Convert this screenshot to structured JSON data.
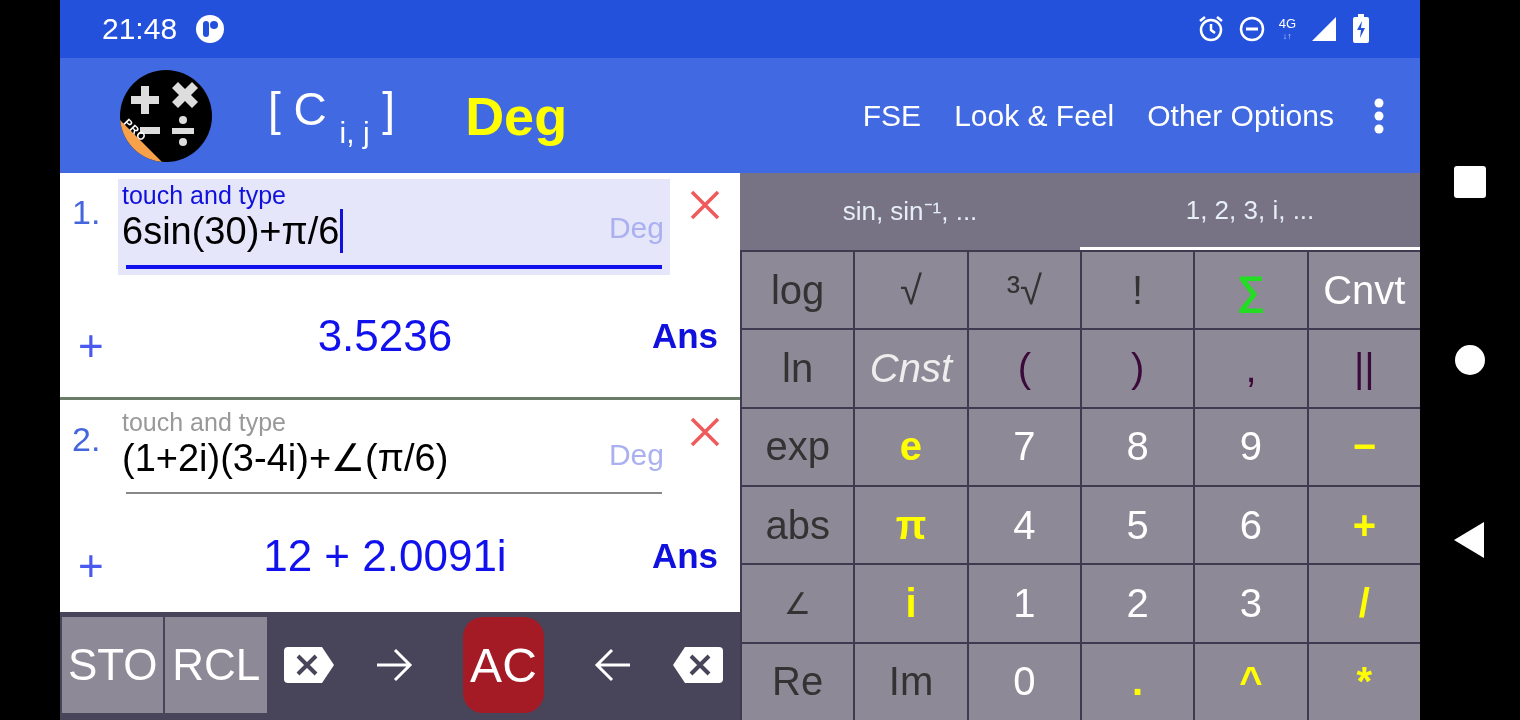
{
  "status_bar": {
    "time": "21:48",
    "network": "4G",
    "network_arrows": "↓↑"
  },
  "app_bar": {
    "logo_badge": "PRO",
    "title": "[ C $_{i, j}$ ]",
    "mode": "Deg",
    "menu": [
      "FSE",
      "Look & Feel",
      "Other Options"
    ]
  },
  "entries": [
    {
      "number": "1.",
      "hint": "touch and type",
      "expression": "6sin(30)+π/6",
      "mode": "Deg",
      "result": "3.5236",
      "answer": "Ans",
      "add": "+",
      "focused": true
    },
    {
      "number": "2.",
      "hint": "touch and type",
      "expression": "(1+2i)(3-4i)+∠(π/6)",
      "mode": "Deg",
      "result": "12 + 2.0091i",
      "answer": "Ans",
      "add": "+",
      "focused": false
    }
  ],
  "action_bar": [
    {
      "kind": "memory",
      "label": "STO"
    },
    {
      "kind": "memory",
      "label": "RCL"
    },
    {
      "kind": "delete-forward"
    },
    {
      "kind": "cursor-right"
    },
    {
      "kind": "clear",
      "label": "AC"
    },
    {
      "kind": "cursor-left"
    },
    {
      "kind": "backspace"
    }
  ],
  "keypad_tabs": [
    {
      "label": "sin, sin⁻¹, ...",
      "selected": false
    },
    {
      "label": "1, 2, 3, i, ...",
      "selected": true
    }
  ],
  "keys": [
    {
      "label": "log",
      "kind": "function"
    },
    {
      "label": "√",
      "kind": "function"
    },
    {
      "label": "³√",
      "kind": "function"
    },
    {
      "label": "!",
      "kind": "function"
    },
    {
      "label": "∑",
      "kind": "sum"
    },
    {
      "label": "Cnvt",
      "kind": "menu"
    },
    {
      "label": "ln",
      "kind": "function"
    },
    {
      "label": "Cnst",
      "kind": "constants"
    },
    {
      "label": "(",
      "kind": "bracket"
    },
    {
      "label": ")",
      "kind": "bracket"
    },
    {
      "label": ",",
      "kind": "bracket"
    },
    {
      "label": "||",
      "kind": "bracket"
    },
    {
      "label": "exp",
      "kind": "function"
    },
    {
      "label": "e",
      "kind": "constant"
    },
    {
      "label": "7",
      "kind": "digit"
    },
    {
      "label": "8",
      "kind": "digit"
    },
    {
      "label": "9",
      "kind": "digit"
    },
    {
      "label": "−",
      "kind": "operator"
    },
    {
      "label": "abs",
      "kind": "function"
    },
    {
      "label": "π",
      "kind": "constant"
    },
    {
      "label": "4",
      "kind": "digit"
    },
    {
      "label": "5",
      "kind": "digit"
    },
    {
      "label": "6",
      "kind": "digit"
    },
    {
      "label": "+",
      "kind": "operator"
    },
    {
      "label": "∠",
      "kind": "angle"
    },
    {
      "label": "i",
      "kind": "constant"
    },
    {
      "label": "1",
      "kind": "digit"
    },
    {
      "label": "2",
      "kind": "digit"
    },
    {
      "label": "3",
      "kind": "digit"
    },
    {
      "label": "/",
      "kind": "operator"
    },
    {
      "label": "Re",
      "kind": "function"
    },
    {
      "label": "Im",
      "kind": "function"
    },
    {
      "label": "0",
      "kind": "digit"
    },
    {
      "label": ".",
      "kind": "operator"
    },
    {
      "label": "^",
      "kind": "operator"
    },
    {
      "label": "*",
      "kind": "operator"
    }
  ]
}
